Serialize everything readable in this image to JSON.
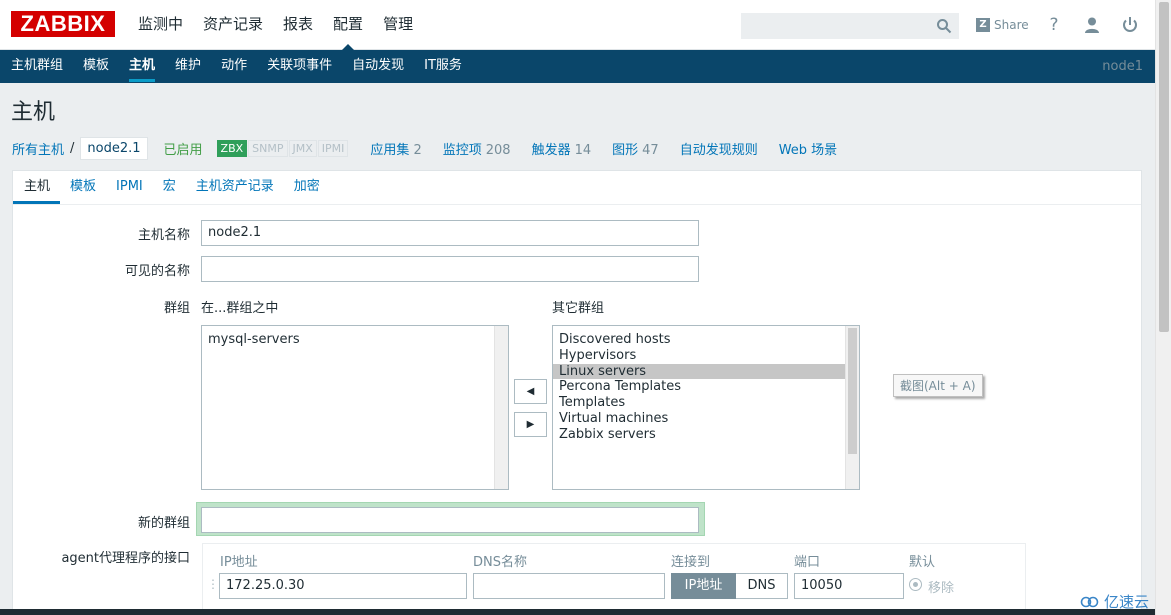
{
  "header": {
    "logo": "ZABBIX",
    "menu": [
      "监测中",
      "资产记录",
      "报表",
      "配置",
      "管理"
    ],
    "share": "Share",
    "help": "?",
    "colors": {
      "logo": "#d40000",
      "subnav": "#0a466a"
    }
  },
  "subnav": {
    "items": [
      "主机群组",
      "模板",
      "主机",
      "维护",
      "动作",
      "关联项事件",
      "自动发现",
      "IT服务"
    ],
    "node": "node1"
  },
  "page": {
    "title": "主机"
  },
  "breadcrumb": {
    "all_hosts": "所有主机",
    "sep": "/",
    "current": "node2.1",
    "status": "已启用",
    "tags": [
      "ZBX",
      "SNMP",
      "JMX",
      "IPMI"
    ],
    "links": [
      {
        "label": "应用集",
        "count": "2"
      },
      {
        "label": "监控项",
        "count": "208"
      },
      {
        "label": "触发器",
        "count": "14"
      },
      {
        "label": "图形",
        "count": "47"
      },
      {
        "label": "自动发现规则",
        "count": ""
      },
      {
        "label": "Web 场景",
        "count": ""
      }
    ]
  },
  "tabs": [
    "主机",
    "模板",
    "IPMI",
    "宏",
    "主机资产记录",
    "加密"
  ],
  "form": {
    "host_name_label": "主机名称",
    "host_name_value": "node2.1",
    "visible_name_label": "可见的名称",
    "visible_name_value": "",
    "groups_label": "群组",
    "in_groups_label": "在...群组之中",
    "other_groups_label": "其它群组",
    "in_groups": [
      "mysql-servers"
    ],
    "other_groups": [
      "Discovered hosts",
      "Hypervisors",
      "Linux servers",
      "Percona Templates",
      "Templates",
      "Virtual machines",
      "Zabbix servers"
    ],
    "selected_other_group": "Linux servers",
    "move_left": "◀",
    "move_right": "▶",
    "new_group_label": "新的群组",
    "new_group_value": "",
    "agent_label": "agent代理程序的接口",
    "iface_headers": {
      "ip": "IP地址",
      "dns": "DNS名称",
      "connect": "连接到",
      "port": "端口",
      "default": "默认"
    },
    "ip_value": "172.25.0.30",
    "dns_value": "",
    "connect_options": [
      "IP地址",
      "DNS"
    ],
    "port_value": "10050",
    "remove": "移除"
  },
  "tooltip": "截图(Alt + A)",
  "watermark": "亿速云"
}
